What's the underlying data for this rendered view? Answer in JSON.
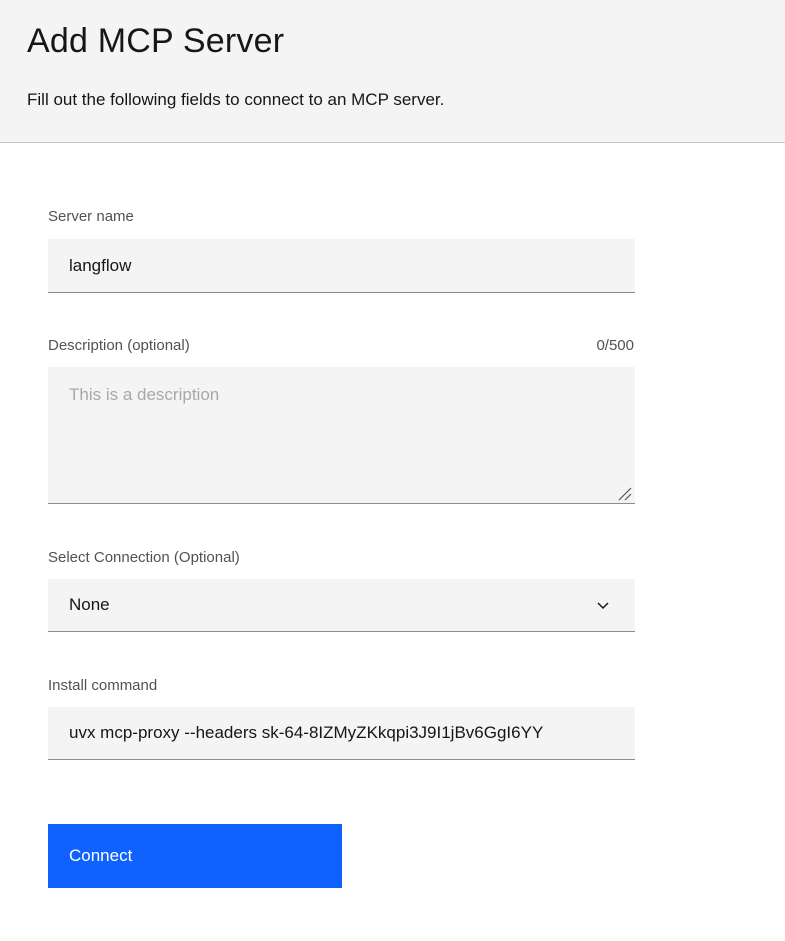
{
  "header": {
    "title": "Add MCP Server",
    "subtitle": "Fill out the following fields to connect to an MCP server."
  },
  "form": {
    "server_name": {
      "label": "Server name",
      "value": "langflow"
    },
    "description": {
      "label": "Description (optional)",
      "counter": "0/500",
      "placeholder": "This is a description",
      "value": ""
    },
    "connection": {
      "label": "Select Connection (Optional)",
      "selected": "None"
    },
    "install_command": {
      "label": "Install command",
      "value": "uvx mcp-proxy --headers sk-64-8IZMyZKkqpi3J9I1jBv6GgI6YY"
    },
    "connect_button": {
      "label": "Connect"
    }
  },
  "icons": {
    "select_chevron": "chevron-down-icon",
    "resize": "resize-handle-icon"
  },
  "colors": {
    "primary": "#0f62fe",
    "field_bg": "#f4f4f4",
    "header_bg": "#f4f4f4"
  }
}
